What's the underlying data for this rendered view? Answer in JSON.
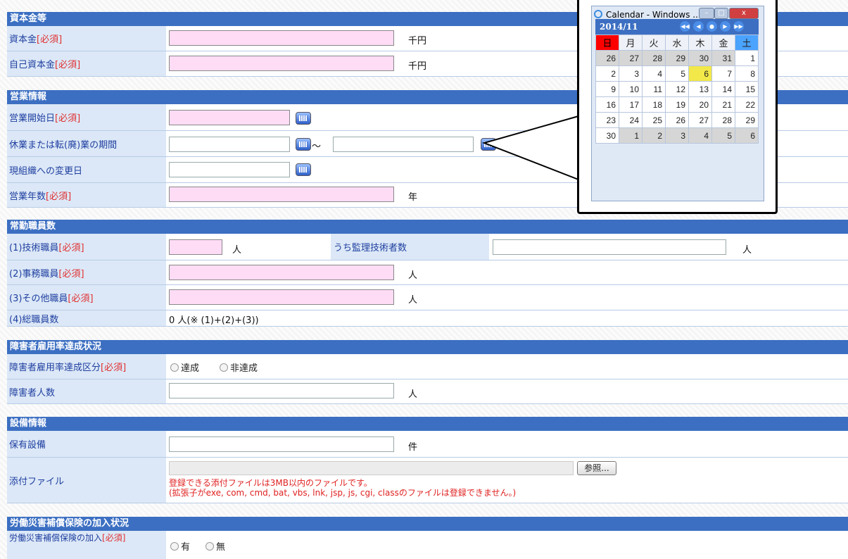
{
  "sections": {
    "capital": {
      "title": "資本金等",
      "capital_label": "資本金",
      "capital_unit": "千円",
      "equity_label": "自己資本金",
      "equity_unit": "千円"
    },
    "business": {
      "title": "営業情報",
      "start_label": "営業開始日",
      "suspend_label": "休業または転(廃)業の期間",
      "tilde": "～",
      "change_label": "現組織への変更日",
      "years_label": "営業年数",
      "years_unit": "年"
    },
    "staff": {
      "title": "常勤職員数",
      "tech_label": "(1)技術職員",
      "tech_unit": "人",
      "supervisor_label": "うち監理技術者数",
      "supervisor_unit": "人",
      "office_label": "(2)事務職員",
      "office_unit": "人",
      "other_label": "(3)その他職員",
      "other_unit": "人",
      "total_label": "(4)総職員数",
      "total_value": "0 人(※ (1)+(2)+(3))"
    },
    "disability": {
      "title": "障害者雇用率達成状況",
      "category_label": "障害者雇用率達成区分",
      "opt_achieved": "達成",
      "opt_not": "非達成",
      "count_label": "障害者人数",
      "count_unit": "人"
    },
    "equipment": {
      "title": "設備情報",
      "owned_label": "保有設備",
      "owned_unit": "件",
      "attach_label": "添付ファイル",
      "browse_label": "参照...",
      "attach_note1": "登録できる添付ファイルは3MB以内のファイルです。",
      "attach_note2": "(拡張子がexe, com, cmd, bat, vbs, lnk, jsp, js, cgi, classのファイルは登録できません。)"
    },
    "insurance": {
      "title": "労働災害補償保険の加入状況",
      "join_label": "労働災害補償保険の加入",
      "opt_yes": "有",
      "opt_no": "無"
    }
  },
  "required_mark": "[必須]",
  "calendar": {
    "window_title": "Calendar - Windows ...",
    "month": "2014/11",
    "weekdays": [
      "日",
      "月",
      "火",
      "水",
      "木",
      "金",
      "土"
    ],
    "weeks": [
      [
        "26",
        "27",
        "28",
        "29",
        "30",
        "31",
        "1"
      ],
      [
        "2",
        "3",
        "4",
        "5",
        "6",
        "7",
        "8"
      ],
      [
        "9",
        "10",
        "11",
        "12",
        "13",
        "14",
        "15"
      ],
      [
        "16",
        "17",
        "18",
        "19",
        "20",
        "21",
        "22"
      ],
      [
        "23",
        "24",
        "25",
        "26",
        "27",
        "28",
        "29"
      ],
      [
        "30",
        "1",
        "2",
        "3",
        "4",
        "5",
        "6"
      ]
    ],
    "today": "6",
    "colors": {
      "sunday": "#ff0000",
      "saturday": "#4aa3ff",
      "today": "#f2e84a",
      "other_month": "#d6d6d6"
    }
  }
}
